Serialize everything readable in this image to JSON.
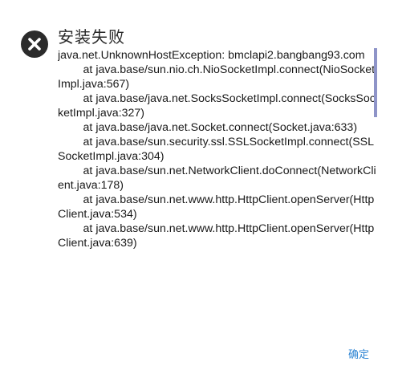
{
  "dialog": {
    "title": "安装失败",
    "message": "java.net.UnknownHostException: bmclapi2.bangbang93.com\n\tat java.base/sun.nio.ch.NioSocketImpl.connect(NioSocketImpl.java:567)\n\tat java.base/java.net.SocksSocketImpl.connect(SocksSocketImpl.java:327)\n\tat java.base/java.net.Socket.connect(Socket.java:633)\n\tat java.base/sun.security.ssl.SSLSocketImpl.connect(SSLSocketImpl.java:304)\n\tat java.base/sun.net.NetworkClient.doConnect(NetworkClient.java:178)\n\tat java.base/sun.net.www.http.HttpClient.openServer(HttpClient.java:534)\n\tat java.base/sun.net.www.http.HttpClient.openServer(HttpClient.java:639)",
    "ok_label": "确定",
    "icon": "error-circle-icon",
    "accent_color": "#2f86d4",
    "scrollbar_color": "#8e94c8"
  }
}
